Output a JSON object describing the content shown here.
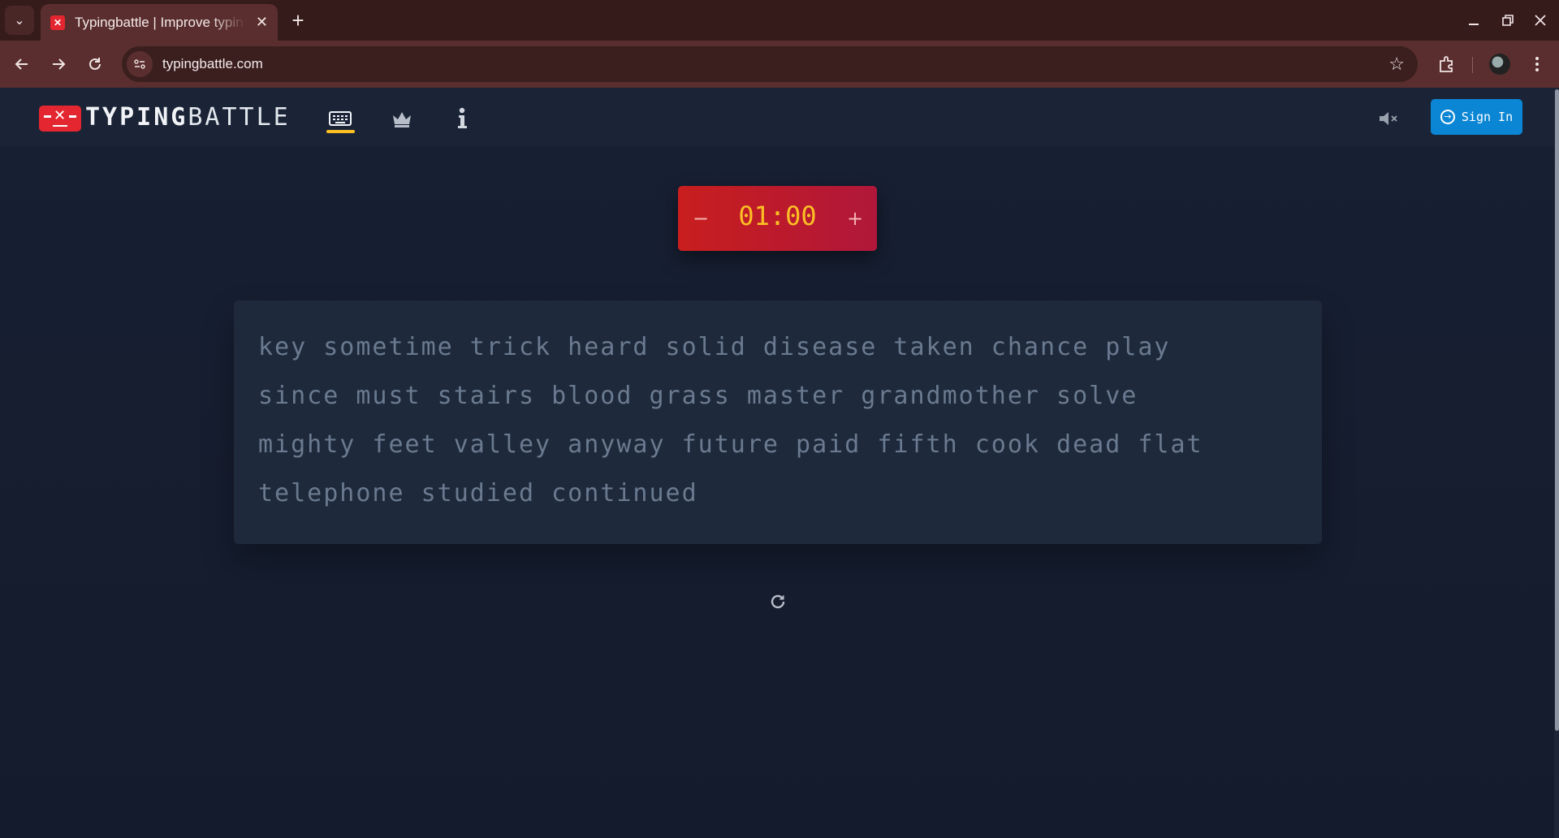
{
  "browser": {
    "tab_title": "Typingbattle | Improve typing",
    "url": "typingbattle.com",
    "new_tab": "+",
    "tab_close": "✕"
  },
  "header": {
    "brand_bold": "TYPING",
    "brand_light": "BATTLE",
    "signin_label": "Sign In",
    "active_color": "#fbbf24",
    "accent": "#e3262f",
    "signin_color": "#0b86d4"
  },
  "timer": {
    "minus": "−",
    "value": "01:00",
    "plus": "+"
  },
  "words": {
    "lines": [
      "key sometime trick heard solid disease taken chance play",
      "since must stairs blood grass master grandmother solve",
      "mighty feet valley anyway future paid fifth cook dead flat",
      "telephone studied continued"
    ]
  },
  "icons": {
    "tab_dropdown": "chevron-down-icon",
    "nav_typing": "keyboard-icon",
    "nav_leaderboard": "crown-icon",
    "nav_info": "info-icon",
    "sound": "volume-mute-icon",
    "restart": "restart-icon",
    "signin": "sign-in-icon"
  }
}
